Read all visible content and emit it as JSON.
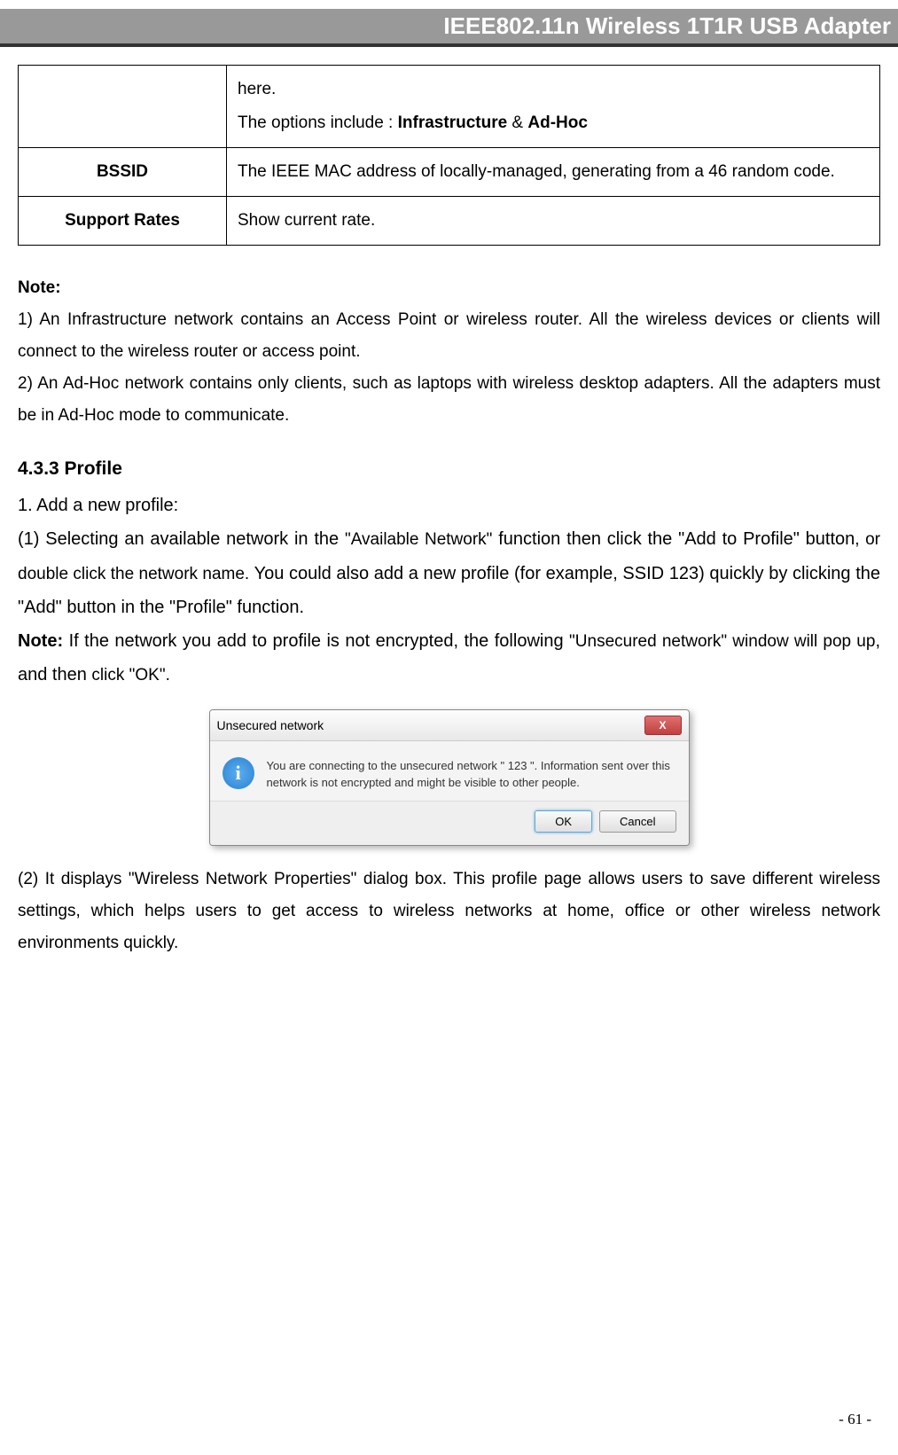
{
  "header": {
    "title": "IEEE802.11n Wireless 1T1R USB Adapter"
  },
  "table": {
    "rows": [
      {
        "label": "",
        "desc_prefix": "here.",
        "desc_line2_prefix": "The options include : ",
        "desc_bold1": "Infrastructure",
        "desc_amp": " & ",
        "desc_bold2": "Ad-Hoc"
      },
      {
        "label": "BSSID",
        "desc": "The IEEE MAC address of locally-managed, generating from a 46 random code."
      },
      {
        "label": "Support Rates",
        "desc": "Show current rate."
      }
    ]
  },
  "note": {
    "title": "Note:",
    "item1": "1) An Infrastructure network contains an Access Point or wireless router. All the wireless devices or clients will connect to the wireless router or access point.",
    "item2": "2) An Ad-Hoc network contains only clients, such as laptops with wireless desktop adapters. All the adapters must be in Ad-Hoc mode to communicate."
  },
  "section": {
    "heading": "4.3.3    Profile",
    "line1": "1. Add a new profile:",
    "para1_a": "(1) Selecting an available network in the ",
    "para1_b": "\"Available Network\"",
    "para1_c": " function then click the \"Add to Profile\" button",
    "para1_d": ", or double click the network name. ",
    "para1_e": "You could also add a new profile (for example, SSID 123) quickly by clicking the \"Add\" button in the \"Profile\" function.",
    "note_bold": "Note:",
    "note_text_a": " If the network you add to profile is not encrypted, the following ",
    "note_text_b": "\"Unsecured network\" window will pop up",
    "note_text_c": ", and then ",
    "note_text_d": "click \"OK\".",
    "para2": "(2) It displays \"Wireless Network Properties\" dialog box. This profile page allows users to save different wireless settings, which helps users to get access to wireless networks at home, office or other wireless network environments quickly."
  },
  "dialog": {
    "title": "Unsecured network",
    "close": "X",
    "icon": "i",
    "message": "You are connecting to the unsecured network \" 123 \". Information sent over this network is not encrypted and might be visible to other people.",
    "ok": "OK",
    "cancel": "Cancel"
  },
  "footer": {
    "page": "- 61 -"
  }
}
